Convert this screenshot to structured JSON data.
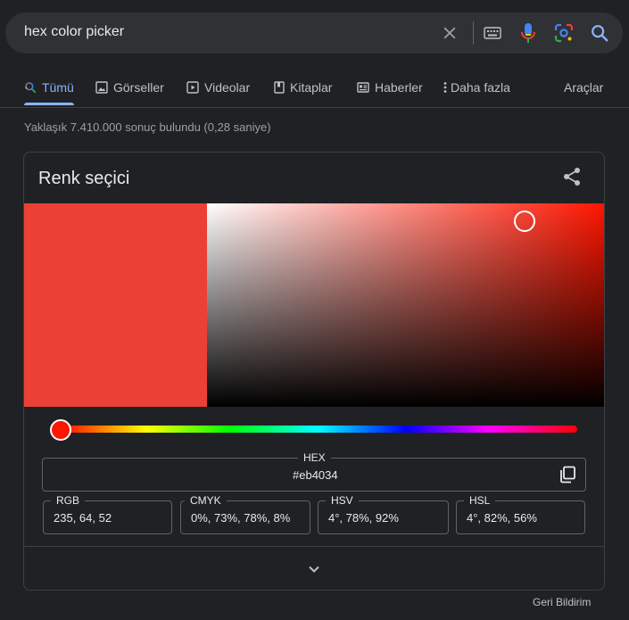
{
  "search": {
    "query": "hex color picker"
  },
  "tabs": [
    {
      "label": "Tümü",
      "icon": "search-icon",
      "active": true
    },
    {
      "label": "Görseller",
      "icon": "image-icon"
    },
    {
      "label": "Videolar",
      "icon": "video-icon"
    },
    {
      "label": "Kitaplar",
      "icon": "book-icon"
    },
    {
      "label": "Haberler",
      "icon": "news-icon"
    },
    {
      "label": "Daha fazla",
      "icon": "more-vert-icon"
    }
  ],
  "tools_label": "Araçlar",
  "result_stats": "Yaklaşık 7.410.000 sonuç bulundu (0,28 saniye)",
  "picker": {
    "title": "Renk seçici",
    "current_color": "#eb4034",
    "hue_color": "#ff1500",
    "hue_position": 0.02,
    "saturation": 0.78,
    "value": 0.92,
    "hex": {
      "label": "HEX",
      "value": "#eb4034"
    },
    "rgb": {
      "label": "RGB",
      "value": "235, 64, 52"
    },
    "cmyk": {
      "label": "CMYK",
      "value": "0%, 73%, 78%, 8%"
    },
    "hsv": {
      "label": "HSV",
      "value": "4°, 78%, 92%"
    },
    "hsl": {
      "label": "HSL",
      "value": "4°, 82%, 56%"
    }
  },
  "feedback_label": "Geri Bildirim",
  "colors": {
    "background": "#202124",
    "search_bg": "#303134",
    "accent_blue": "#8ab4f8",
    "text_primary": "#e8eaed",
    "text_secondary": "#bdc1c6"
  }
}
